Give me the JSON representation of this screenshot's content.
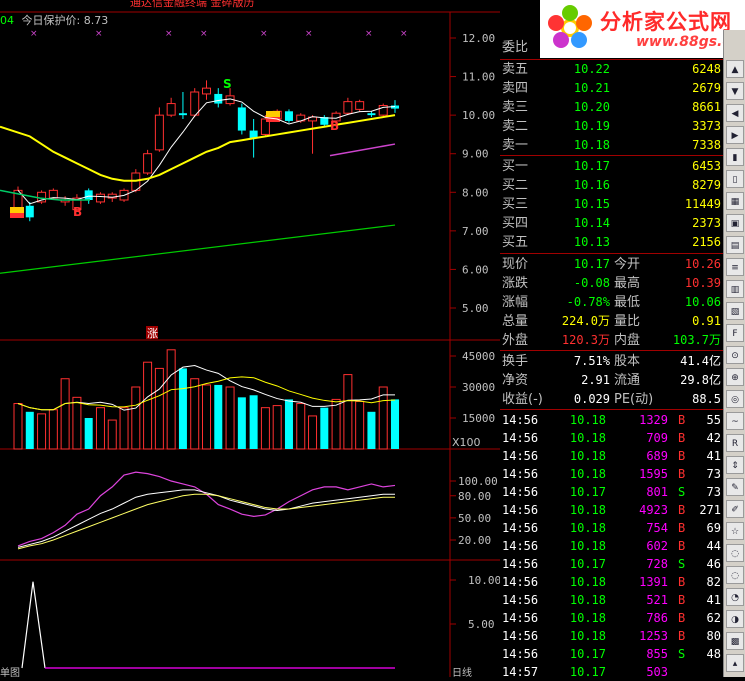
{
  "header": {
    "indicator_prefix": "04",
    "indicator_name": "今日保护价: 8.73",
    "top_text": "通达信金融终端    金碎版历"
  },
  "logo": {
    "title": "分析家公式网",
    "url": "www.88gs.com"
  },
  "price_axis": [
    "12.00",
    "11.00",
    "10.00",
    "9.00",
    "8.00",
    "7.00",
    "6.00",
    "5.00"
  ],
  "volume_axis": [
    "45000",
    "30000",
    "15000"
  ],
  "volume_unit": "X100",
  "osc_axis": [
    "100.00",
    "80.00",
    "50.00",
    "20.00"
  ],
  "bottom_axis": [
    "10.00",
    "5.00"
  ],
  "markers": {
    "s": "S",
    "b1": "B",
    "b2": "B",
    "zhang": "涨"
  },
  "bottom_labels": {
    "left": "单图",
    "right": "日线"
  },
  "quote": {
    "ratio_label": "委比",
    "sells": [
      {
        "label": "卖五",
        "price": "10.22",
        "vol": "6248"
      },
      {
        "label": "卖四",
        "price": "10.21",
        "vol": "2679"
      },
      {
        "label": "卖三",
        "price": "10.20",
        "vol": "8661"
      },
      {
        "label": "卖二",
        "price": "10.19",
        "vol": "3373"
      },
      {
        "label": "卖一",
        "price": "10.18",
        "vol": "7338"
      }
    ],
    "buys": [
      {
        "label": "买一",
        "price": "10.17",
        "vol": "6453"
      },
      {
        "label": "买二",
        "price": "10.16",
        "vol": "8279"
      },
      {
        "label": "买三",
        "price": "10.15",
        "vol": "11449"
      },
      {
        "label": "买四",
        "price": "10.14",
        "vol": "2373"
      },
      {
        "label": "买五",
        "price": "10.13",
        "vol": "2156"
      }
    ],
    "stats": [
      {
        "l1": "现价",
        "v1": "10.17",
        "l2": "今开",
        "v2": "10.26"
      },
      {
        "l1": "涨跌",
        "v1": "-0.08",
        "l2": "最高",
        "v2": "10.39"
      },
      {
        "l1": "涨幅",
        "v1": "-0.78%",
        "l2": "最低",
        "v2": "10.06"
      },
      {
        "l1": "总量",
        "v1": "224.0万",
        "l2": "量比",
        "v2": "0.91"
      },
      {
        "l1": "外盘",
        "v1": "120.3万",
        "l2": "内盘",
        "v2": "103.7万"
      }
    ],
    "fund": [
      {
        "l1": "换手",
        "v1": "7.51%",
        "l2": "股本",
        "v2": "41.4亿"
      },
      {
        "l1": "净资",
        "v1": "2.91",
        "l2": "流通",
        "v2": "29.8亿"
      },
      {
        "l1": "收益(-)",
        "v1": "0.029",
        "l2": "PE(动)",
        "v2": "88.5"
      }
    ]
  },
  "ticks": [
    {
      "t": "14:56",
      "p": "10.18",
      "v": "1329",
      "s": "B",
      "n": "55"
    },
    {
      "t": "14:56",
      "p": "10.18",
      "v": "709",
      "s": "B",
      "n": "42"
    },
    {
      "t": "14:56",
      "p": "10.18",
      "v": "689",
      "s": "B",
      "n": "41"
    },
    {
      "t": "14:56",
      "p": "10.18",
      "v": "1595",
      "s": "B",
      "n": "73"
    },
    {
      "t": "14:56",
      "p": "10.17",
      "v": "801",
      "s": "S",
      "n": "73"
    },
    {
      "t": "14:56",
      "p": "10.18",
      "v": "4923",
      "s": "B",
      "n": "271"
    },
    {
      "t": "14:56",
      "p": "10.18",
      "v": "754",
      "s": "B",
      "n": "69"
    },
    {
      "t": "14:56",
      "p": "10.18",
      "v": "602",
      "s": "B",
      "n": "44"
    },
    {
      "t": "14:56",
      "p": "10.17",
      "v": "728",
      "s": "S",
      "n": "46"
    },
    {
      "t": "14:56",
      "p": "10.18",
      "v": "1391",
      "s": "B",
      "n": "82"
    },
    {
      "t": "14:56",
      "p": "10.18",
      "v": "521",
      "s": "B",
      "n": "41"
    },
    {
      "t": "14:56",
      "p": "10.18",
      "v": "786",
      "s": "B",
      "n": "62"
    },
    {
      "t": "14:56",
      "p": "10.18",
      "v": "1253",
      "s": "B",
      "n": "80"
    },
    {
      "t": "14:56",
      "p": "10.17",
      "v": "855",
      "s": "S",
      "n": "48"
    },
    {
      "t": "14:57",
      "p": "10.17",
      "v": "503",
      "s": "",
      "n": ""
    }
  ],
  "chart_data": {
    "type": "candlestick",
    "y_range": [
      4.5,
      12.5
    ],
    "candles": [
      {
        "o": 7.55,
        "c": 8.05,
        "h": 8.15,
        "l": 7.45
      },
      {
        "o": 7.65,
        "c": 7.35,
        "h": 7.75,
        "l": 7.25
      },
      {
        "o": 7.75,
        "c": 8.0,
        "h": 8.05,
        "l": 7.7
      },
      {
        "o": 7.85,
        "c": 8.05,
        "h": 8.1,
        "l": 7.8
      },
      {
        "o": 7.75,
        "c": 7.8,
        "h": 7.9,
        "l": 7.65
      },
      {
        "o": 7.55,
        "c": 7.85,
        "h": 7.95,
        "l": 7.5
      },
      {
        "o": 8.05,
        "c": 7.8,
        "h": 8.1,
        "l": 7.7
      },
      {
        "o": 7.75,
        "c": 7.95,
        "h": 8.0,
        "l": 7.7
      },
      {
        "o": 7.85,
        "c": 7.95,
        "h": 8.0,
        "l": 7.75
      },
      {
        "o": 7.8,
        "c": 8.05,
        "h": 8.1,
        "l": 7.75
      },
      {
        "o": 8.05,
        "c": 8.5,
        "h": 8.6,
        "l": 8.0
      },
      {
        "o": 8.5,
        "c": 9.0,
        "h": 9.1,
        "l": 8.45
      },
      {
        "o": 9.1,
        "c": 10.0,
        "h": 10.2,
        "l": 9.05
      },
      {
        "o": 10.0,
        "c": 10.3,
        "h": 10.45,
        "l": 9.95
      },
      {
        "o": 10.05,
        "c": 10.0,
        "h": 10.6,
        "l": 9.9
      },
      {
        "o": 10.0,
        "c": 10.6,
        "h": 10.7,
        "l": 9.95
      },
      {
        "o": 10.55,
        "c": 10.7,
        "h": 10.9,
        "l": 10.4
      },
      {
        "o": 10.55,
        "c": 10.3,
        "h": 10.7,
        "l": 10.2
      },
      {
        "o": 10.3,
        "c": 10.5,
        "h": 10.7,
        "l": 10.25
      },
      {
        "o": 10.2,
        "c": 9.6,
        "h": 10.3,
        "l": 9.5
      },
      {
        "o": 9.6,
        "c": 9.4,
        "h": 9.9,
        "l": 8.9
      },
      {
        "o": 9.5,
        "c": 9.9,
        "h": 10.0,
        "l": 9.45
      },
      {
        "o": 9.9,
        "c": 10.1,
        "h": 10.15,
        "l": 9.85
      },
      {
        "o": 10.1,
        "c": 9.85,
        "h": 10.15,
        "l": 9.8
      },
      {
        "o": 9.85,
        "c": 10.0,
        "h": 10.05,
        "l": 9.8
      },
      {
        "o": 9.85,
        "c": 9.95,
        "h": 10.0,
        "l": 9.0
      },
      {
        "o": 9.95,
        "c": 9.75,
        "h": 10.0,
        "l": 9.7
      },
      {
        "o": 9.85,
        "c": 10.05,
        "h": 10.1,
        "l": 9.8
      },
      {
        "o": 10.05,
        "c": 10.35,
        "h": 10.45,
        "l": 10.0
      },
      {
        "o": 10.15,
        "c": 10.35,
        "h": 10.4,
        "l": 10.1
      },
      {
        "o": 10.05,
        "c": 10.0,
        "h": 10.1,
        "l": 9.95
      },
      {
        "o": 10.0,
        "c": 10.25,
        "h": 10.3,
        "l": 9.95
      },
      {
        "o": 10.25,
        "c": 10.17,
        "h": 10.39,
        "l": 10.06
      }
    ],
    "ma_yellow": [
      9.7,
      9.45,
      9.25,
      9.05,
      8.9,
      8.75,
      8.6,
      8.45,
      8.35,
      8.3,
      8.3,
      8.35,
      8.45,
      8.6,
      8.75,
      8.9,
      9.05,
      9.15,
      9.3,
      9.35,
      9.4,
      9.45,
      9.5,
      9.55,
      9.6,
      9.65,
      9.7,
      9.75,
      9.8,
      9.85,
      9.9,
      9.95,
      10.0
    ],
    "ma_purple_x": [
      330,
      395
    ],
    "ma_purple_y": [
      8.95,
      9.25
    ],
    "ma_green_y": [
      5.9,
      7.15
    ],
    "volume": [
      22000,
      18000,
      17000,
      19000,
      34000,
      25000,
      15000,
      20000,
      14000,
      20000,
      30000,
      42000,
      39000,
      48000,
      39000,
      34000,
      31000,
      31000,
      30000,
      25000,
      26000,
      20000,
      21000,
      24000,
      22000,
      16000,
      20000,
      24000,
      36000,
      23000,
      18000,
      30000,
      24000
    ]
  }
}
